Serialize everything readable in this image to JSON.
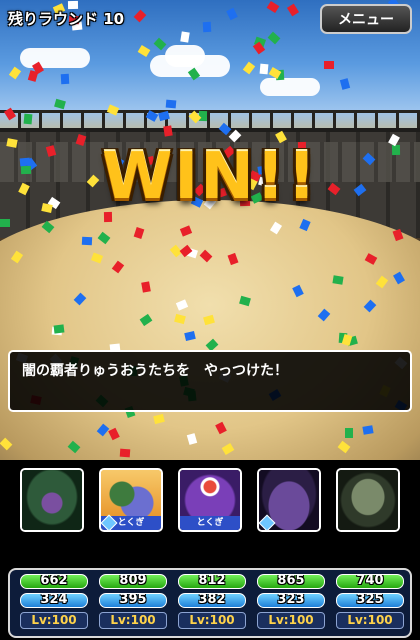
{
  "header": {
    "round_label": "残りラウンド 10",
    "menu_label": "メニュー"
  },
  "banner": {
    "text": "WIN!!"
  },
  "message": {
    "text": "闇の覇者りゅうおうたちを　やっつけた！"
  },
  "party": [
    {
      "name": "hooded-rogue",
      "tag": "",
      "special": false,
      "hp": "662",
      "mp": "324",
      "level": "Lv:100",
      "hp_fill": 0.95,
      "mp_fill": 0.9
    },
    {
      "name": "dragon-rider",
      "tag": "とくぎ",
      "special": true,
      "hp": "809",
      "mp": "395",
      "level": "Lv:100",
      "hp_fill": 0.95,
      "mp_fill": 0.9
    },
    {
      "name": "eye-demon",
      "tag": "とくぎ",
      "special": true,
      "hp": "812",
      "mp": "382",
      "level": "Lv:100",
      "hp_fill": 0.95,
      "mp_fill": 0.9
    },
    {
      "name": "horned-beast",
      "tag": "",
      "special": false,
      "hp": "865",
      "mp": "323",
      "level": "Lv:100",
      "hp_fill": 0.95,
      "mp_fill": 0.9
    },
    {
      "name": "skeleton-warrior",
      "tag": "",
      "special": false,
      "hp": "740",
      "mp": "325",
      "level": "Lv:100",
      "hp_fill": 0.95,
      "mp_fill": 0.9
    }
  ],
  "colors": {
    "win_gold": "#ffc21a",
    "hp_green": "#3ccf1e",
    "mp_blue": "#2a9af0",
    "panel_navy": "#0d1c3a"
  }
}
